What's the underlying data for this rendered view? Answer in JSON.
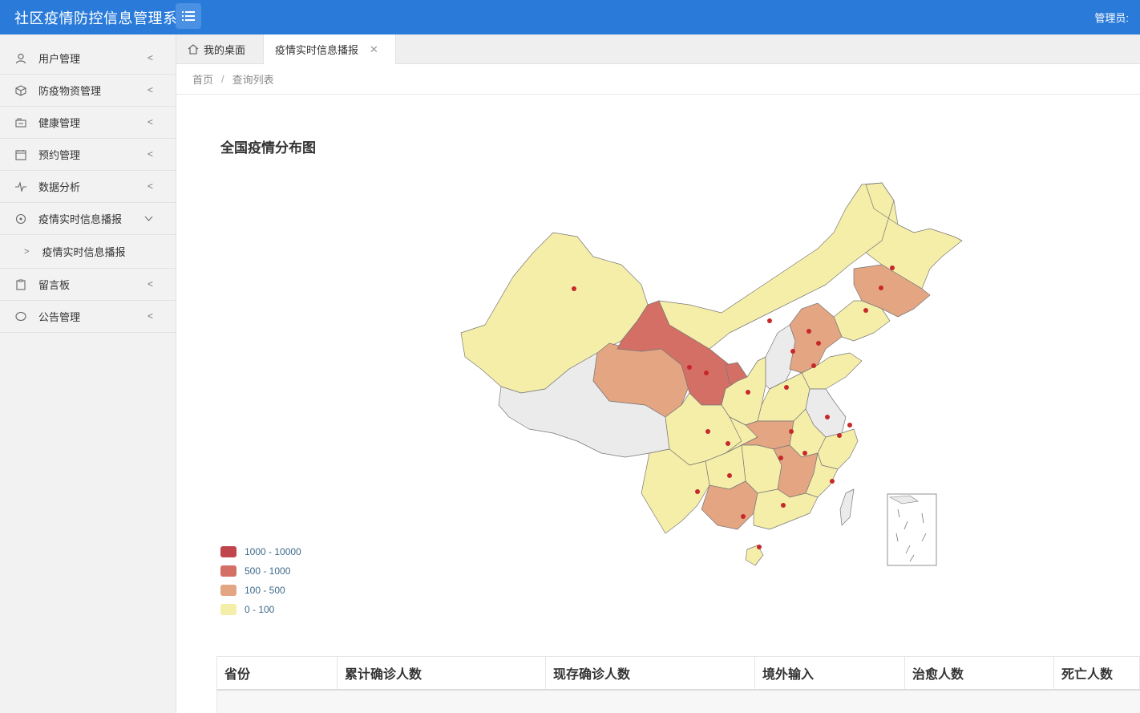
{
  "header": {
    "app_title": "社区疫情防控信息管理系",
    "user_label": "管理员:"
  },
  "sidebar": {
    "items": [
      {
        "label": "用户管理",
        "icon": "user-icon"
      },
      {
        "label": "防疫物资管理",
        "icon": "cube-icon"
      },
      {
        "label": "健康管理",
        "icon": "health-icon"
      },
      {
        "label": "预约管理",
        "icon": "calendar-icon"
      },
      {
        "label": "数据分析",
        "icon": "pulse-icon"
      },
      {
        "label": "疫情实时信息播报",
        "icon": "broadcast-icon"
      },
      {
        "label": "留言板",
        "icon": "clipboard-icon"
      },
      {
        "label": "公告管理",
        "icon": "chat-icon"
      }
    ],
    "sub_item": "疫情实时信息播报"
  },
  "tabs": {
    "home": "我的桌面",
    "active": "疫情实时信息播报"
  },
  "breadcrumb": {
    "home": "首页",
    "sep": "/",
    "current": "查询列表"
  },
  "map": {
    "title": "全国疫情分布图",
    "legend": [
      {
        "label": "1000 - 10000",
        "color": "#c0454d"
      },
      {
        "label": "500 - 1000",
        "color": "#d46f65"
      },
      {
        "label": "100 - 500",
        "color": "#e4a583"
      },
      {
        "label": "0 - 100",
        "color": "#f5eea9"
      }
    ],
    "colors": {
      "none": "#ebebeb",
      "low": "#f5eea9",
      "mid": "#e4a583",
      "high": "#d46f65",
      "marker": "#c6282b"
    }
  },
  "table": {
    "columns": [
      "省份",
      "累计确诊人数",
      "现存确诊人数",
      "境外输入",
      "治愈人数",
      "死亡人数"
    ]
  }
}
